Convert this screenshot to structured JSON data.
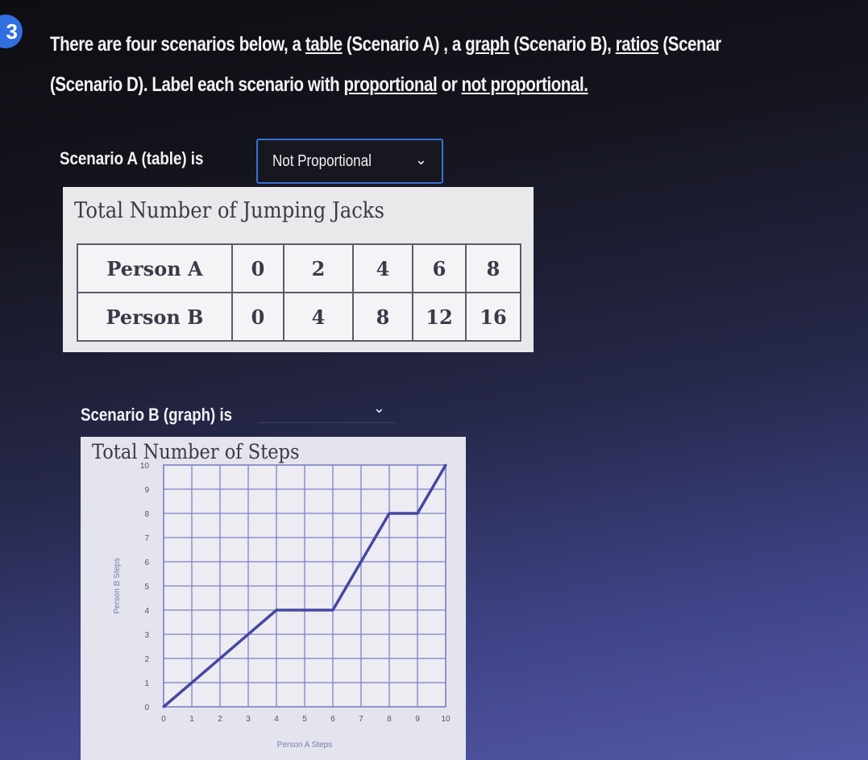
{
  "question": {
    "number": "3",
    "line1_parts": [
      "There are four scenarios below, a ",
      "table",
      " (Scenario A) , a ",
      "graph",
      " (Scenario B), ",
      "ratios",
      " (Scenar"
    ],
    "line2_parts": [
      "(Scenario D). Label each scenario with ",
      "proportional",
      " or ",
      "not proportional."
    ]
  },
  "scenario_a": {
    "label": "Scenario A (table) is",
    "selected": "Not Proportional",
    "table_title": "Total Number of Jumping Jacks",
    "rows": [
      {
        "header": "Person A",
        "values": [
          "0",
          "2",
          "4",
          "6",
          "8"
        ]
      },
      {
        "header": "Person B",
        "values": [
          "0",
          "4",
          "8",
          "12",
          "16"
        ]
      }
    ]
  },
  "scenario_b": {
    "label": "Scenario B (graph) is",
    "selected": ""
  },
  "colors": {
    "accent": "#3a6fd8",
    "badge": "#2f6fe0",
    "line": "#4548a0",
    "grid": "#7d80c8"
  },
  "chart_data": {
    "type": "line",
    "title": "Total Number of Steps",
    "xlabel": "Person A Steps",
    "ylabel": "Person B Steps",
    "xlim": [
      0,
      10
    ],
    "ylim": [
      0,
      10
    ],
    "xticks": [
      "0",
      "1",
      "2",
      "3",
      "4",
      "5",
      "6",
      "7",
      "8",
      "9",
      "10"
    ],
    "yticks": [
      "0",
      "1",
      "2",
      "3",
      "4",
      "5",
      "6",
      "7",
      "8",
      "9",
      "10"
    ],
    "grid": true,
    "series": [
      {
        "x": [
          0,
          4,
          6,
          8,
          9,
          10
        ],
        "y": [
          0,
          4,
          4,
          8,
          8,
          10
        ]
      }
    ]
  }
}
